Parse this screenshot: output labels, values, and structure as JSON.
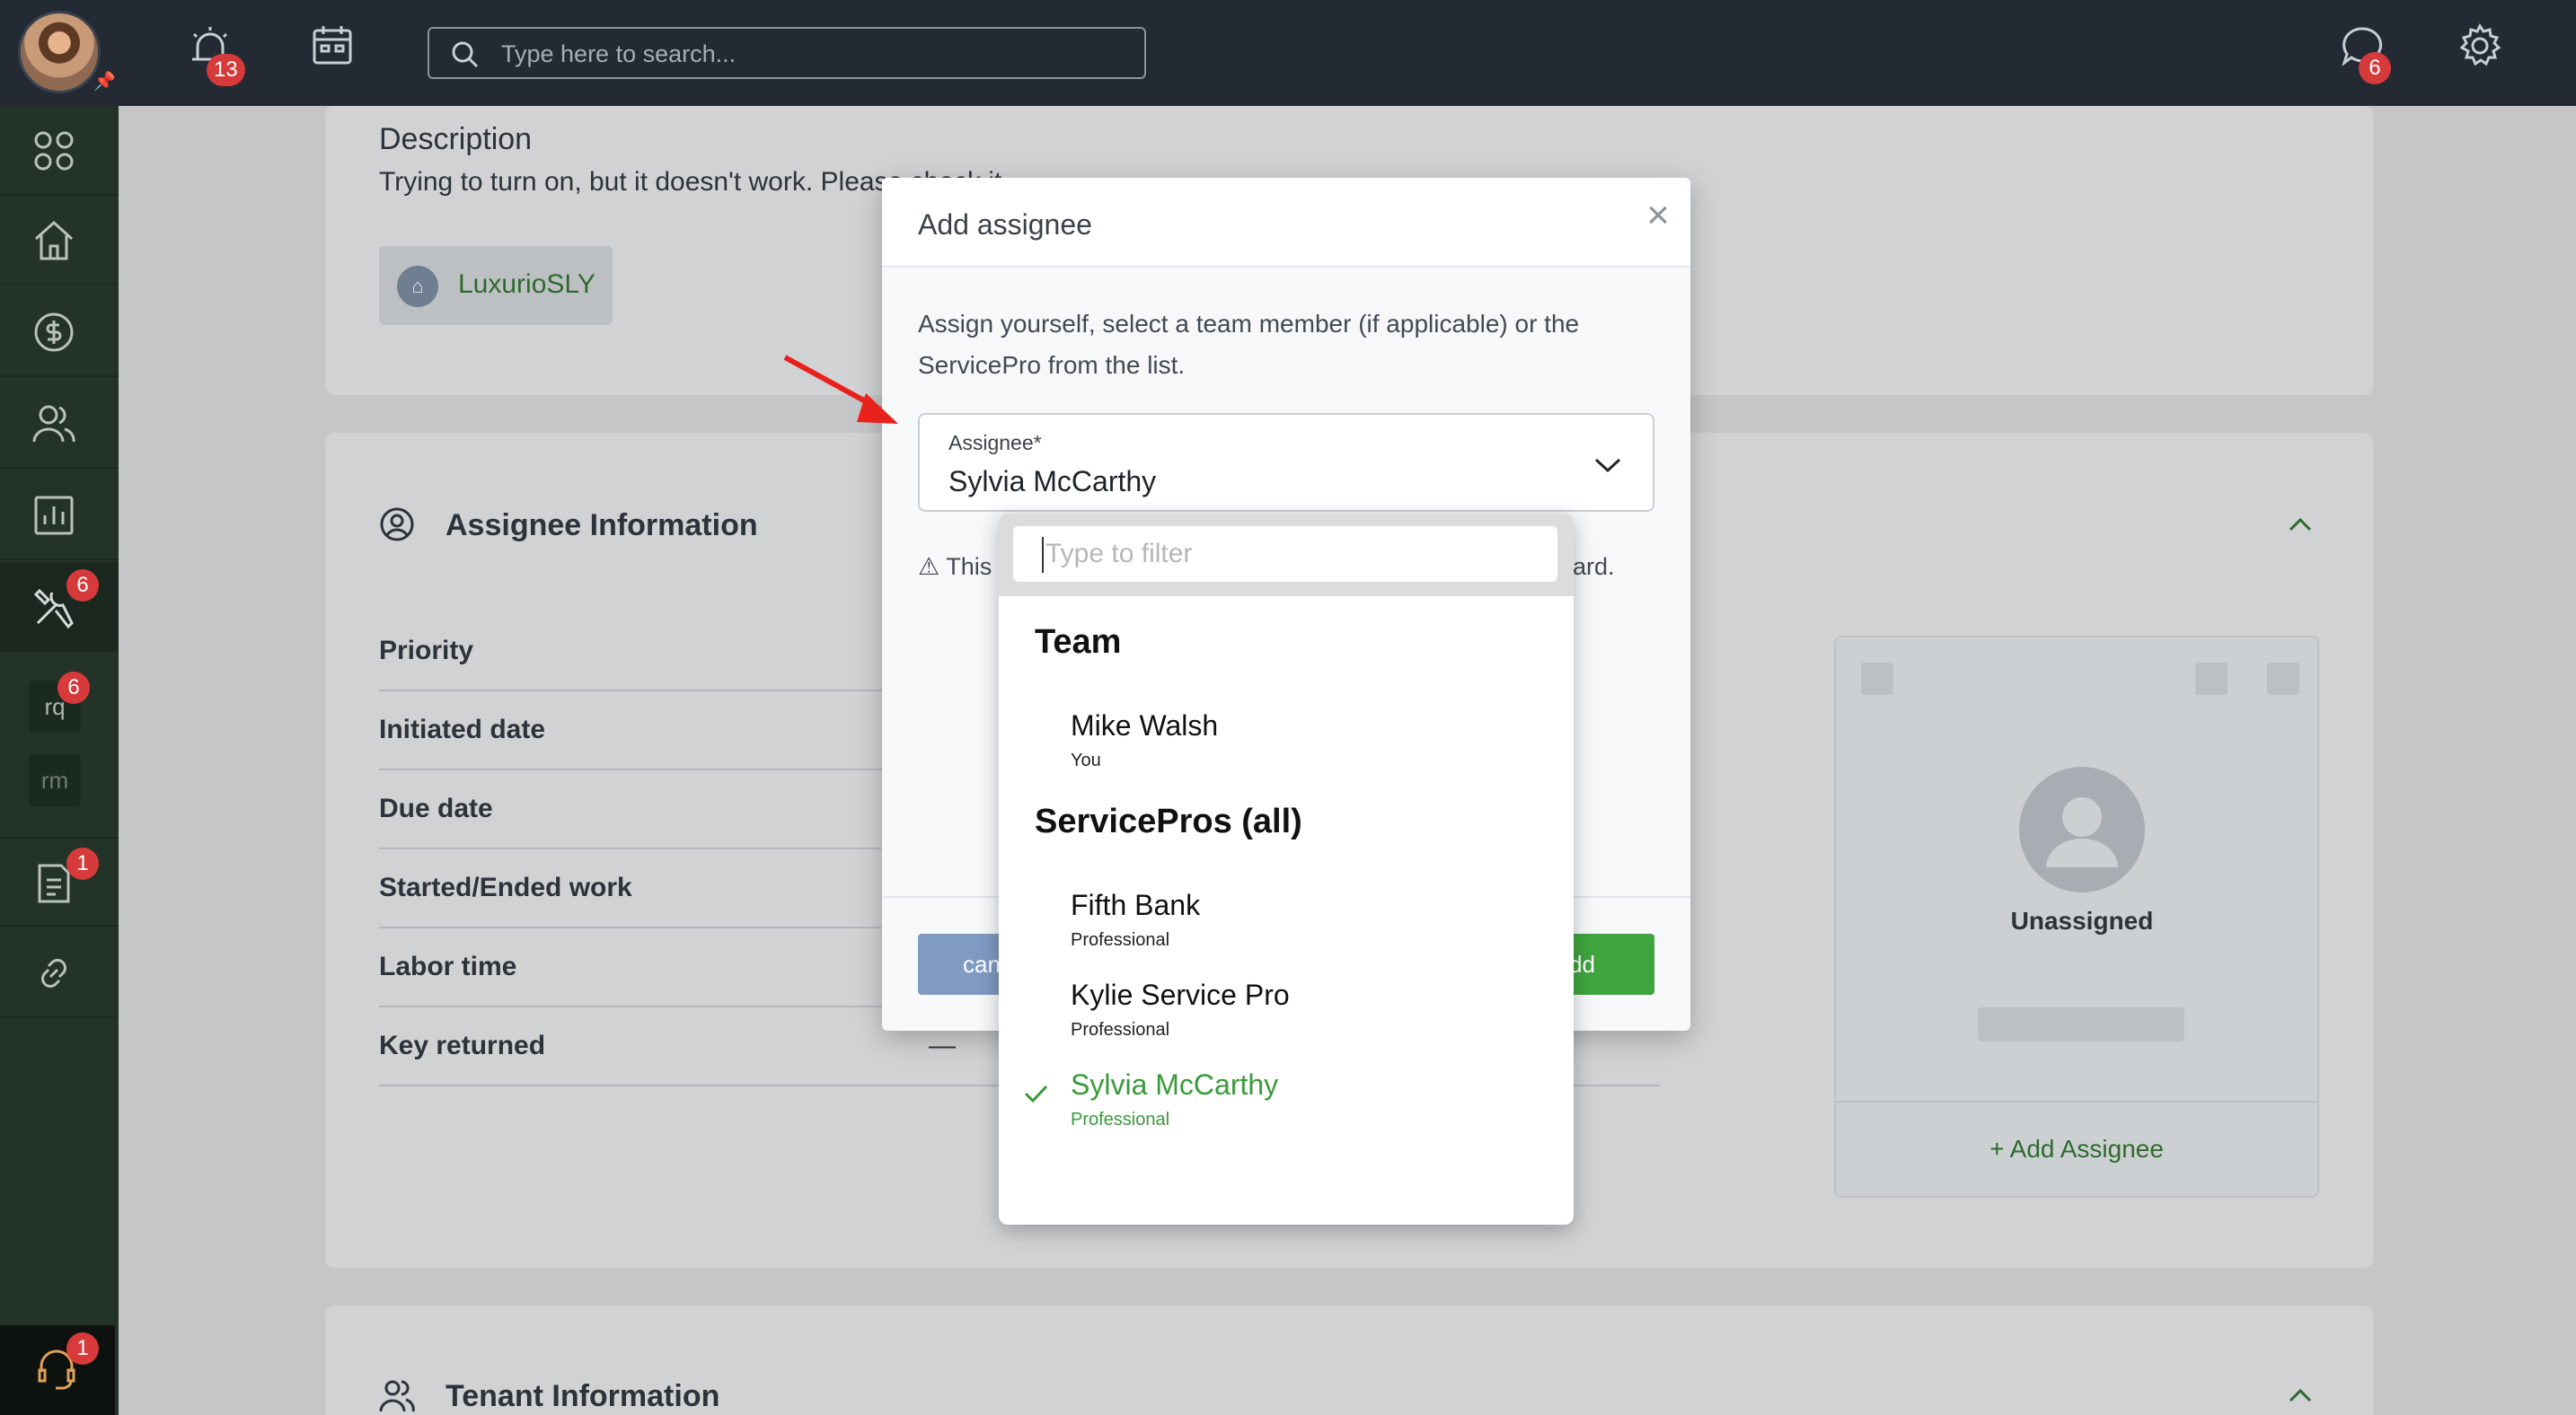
{
  "topbar": {
    "alerts_badge": "13",
    "search_placeholder": "Type here to search...",
    "chat_badge": "6"
  },
  "leftnav": {
    "maintenance_badge": "6",
    "chip_rq": "rq",
    "chip_rq_badge": "6",
    "chip_rm": "rm",
    "docs_badge": "1",
    "support_badge": "1"
  },
  "description": {
    "title": "Description",
    "text": "Trying to turn on, but it doesn't work. Please check it.",
    "property": "LuxurioSLY"
  },
  "assignee_section": {
    "title": "Assignee Information",
    "rows": [
      "Priority",
      "Initiated date",
      "Due date",
      "Started/Ended work",
      "Labor time",
      "Key returned"
    ],
    "key_returned_value": "—",
    "card_status": "Unassigned",
    "add_link": "+ Add Assignee"
  },
  "tenant_section": {
    "title": "Tenant Information"
  },
  "modal": {
    "title": "Add assignee",
    "close": "×",
    "instructions": "Assign yourself, select a team member (if applicable) or the ServicePro from the list.",
    "select_label": "Assignee*",
    "select_value": "Sylvia McCarthy",
    "warning_start": "This",
    "warning_end": "oard.",
    "cancel_label": "can",
    "add_label": "dd"
  },
  "dropdown": {
    "filter_placeholder": "Type to filter",
    "groups": [
      {
        "heading": "Team",
        "options": [
          {
            "name": "Mike Walsh",
            "sub": "You",
            "selected": false
          }
        ]
      },
      {
        "heading": "ServicePros (all)",
        "options": [
          {
            "name": "Fifth Bank",
            "sub": "Professional",
            "selected": false
          },
          {
            "name": "Kylie Service Pro",
            "sub": "Professional",
            "selected": false
          },
          {
            "name": "Sylvia McCarthy",
            "sub": "Professional",
            "selected": true
          }
        ]
      }
    ]
  },
  "colors": {
    "topbar": "#232a34",
    "sidenav": "#243328",
    "accent_green": "#3fa53f",
    "badge_red": "#d63a3a",
    "cancel_blue": "#7f9bc2",
    "annotation_arrow": "#e8211d"
  }
}
